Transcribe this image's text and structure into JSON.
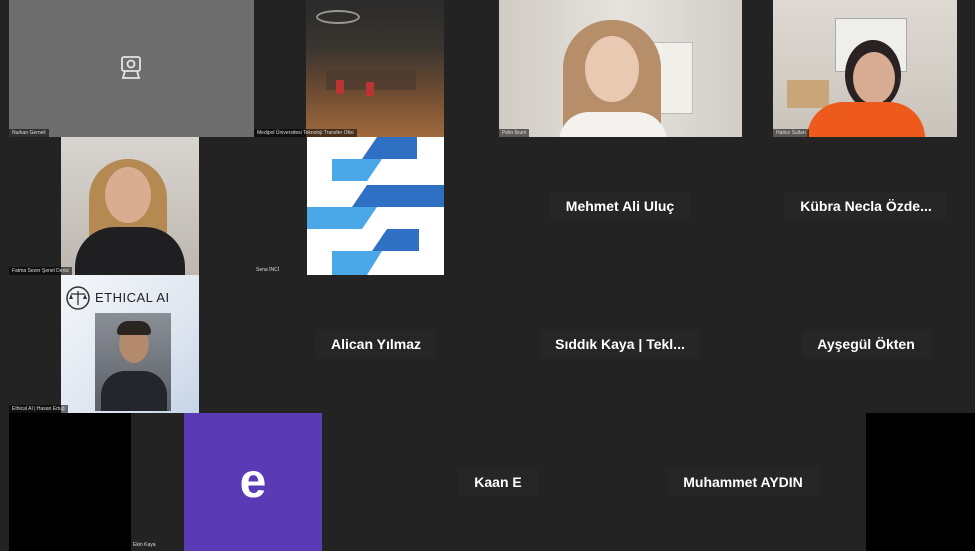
{
  "participants": {
    "p1": {
      "name": "Nurkan Gerneli"
    },
    "p2": {
      "name": "Medipol Üniversitesi Teknoloji Transfer Ofisi"
    },
    "p3": {
      "name": "Pelin İlzum"
    },
    "p4": {
      "name": "Hatice Sultan"
    },
    "p5": {
      "name": "Fatma Sezer Şenel Deniz"
    },
    "p6": {
      "name": "Sena İNCİ"
    },
    "p7": {
      "name": "Mehmet Ali Uluç"
    },
    "p8": {
      "name": "Kübra Necla Özde..."
    },
    "p9": {
      "name": "Ethical AI | Hasan Ertuğ"
    },
    "p9_logo": "ETHICAL AI",
    "p10": {
      "name": "Alican Yılmaz"
    },
    "p11": {
      "name": "Sıddık Kaya | Tekl..."
    },
    "p12": {
      "name": "Ayşegül Ökten"
    },
    "p13": {
      "name": "Ekin Kaya",
      "avatar_letter": "e",
      "avatar_color": "#5b3ab5"
    },
    "p14": {
      "name": "Kaan E"
    },
    "p15": {
      "name": "Muhammet AYDIN"
    }
  },
  "colors": {
    "background": "#232323",
    "logo_blue_dark": "#2f6fc4",
    "logo_blue_light": "#4aa8e8"
  }
}
